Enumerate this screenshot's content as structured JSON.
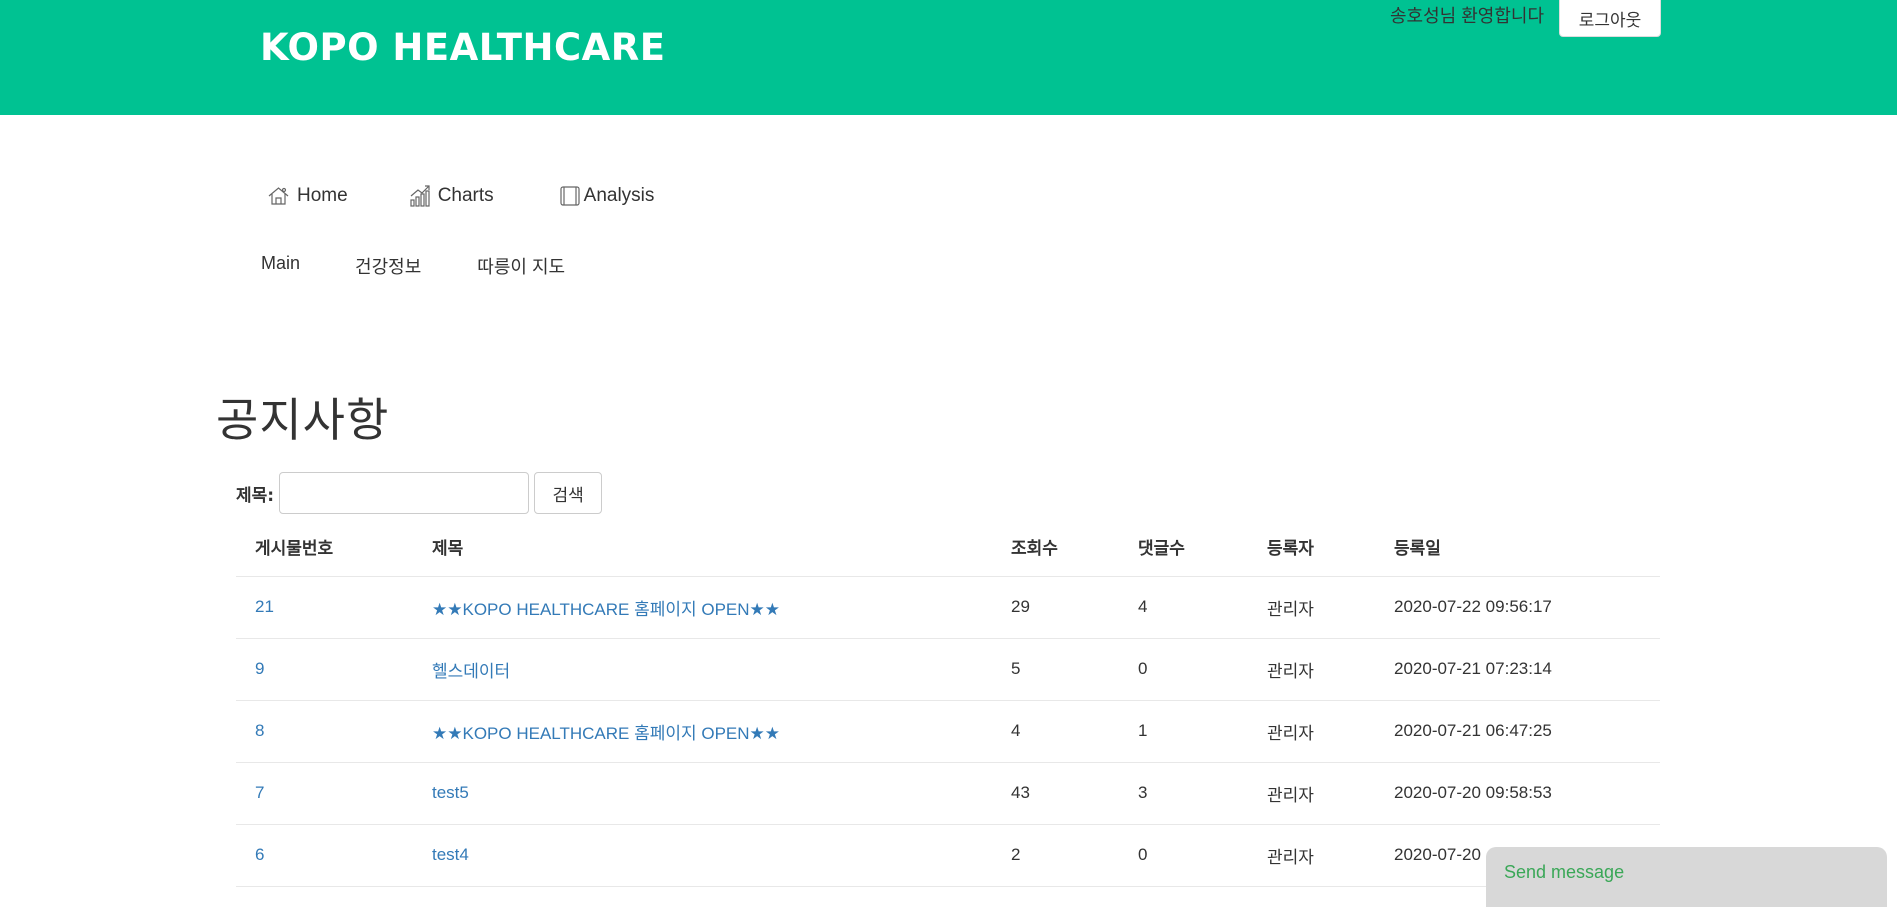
{
  "header": {
    "brand": "KOPO HEALTHCARE",
    "welcome": "송호성님 환영합니다",
    "logout_label": "로그아웃",
    "background_color": "#00c292"
  },
  "nav_primary": [
    {
      "label": "Home",
      "icon": "home-icon"
    },
    {
      "label": "Charts",
      "icon": "chart-icon"
    },
    {
      "label": "Analysis",
      "icon": "tablet-icon"
    }
  ],
  "nav_secondary": [
    {
      "label": "Main"
    },
    {
      "label": "건강정보"
    },
    {
      "label": "따릉이 지도"
    }
  ],
  "page": {
    "title": "공지사항"
  },
  "search": {
    "label": "제목:",
    "value": "",
    "button_label": "검색"
  },
  "table": {
    "columns": [
      "게시물번호",
      "제목",
      "조회수",
      "댓글수",
      "등록자",
      "등록일"
    ],
    "rows": [
      {
        "no": "21",
        "title": "★★KOPO HEALTHCARE 홈페이지 OPEN★★",
        "views": "29",
        "comments": "4",
        "writer": "관리자",
        "date": "2020-07-22 09:56:17"
      },
      {
        "no": "9",
        "title": "헬스데이터",
        "views": "5",
        "comments": "0",
        "writer": "관리자",
        "date": "2020-07-21 07:23:14"
      },
      {
        "no": "8",
        "title": "★★KOPO HEALTHCARE 홈페이지 OPEN★★",
        "views": "4",
        "comments": "1",
        "writer": "관리자",
        "date": "2020-07-21 06:47:25"
      },
      {
        "no": "7",
        "title": "test5",
        "views": "43",
        "comments": "3",
        "writer": "관리자",
        "date": "2020-07-20 09:58:53"
      },
      {
        "no": "6",
        "title": "test4",
        "views": "2",
        "comments": "0",
        "writer": "관리자",
        "date": "2020-07-20"
      }
    ]
  },
  "chat": {
    "label": "Send message"
  },
  "colors": {
    "link": "#337ab7",
    "accent": "#00c292"
  }
}
